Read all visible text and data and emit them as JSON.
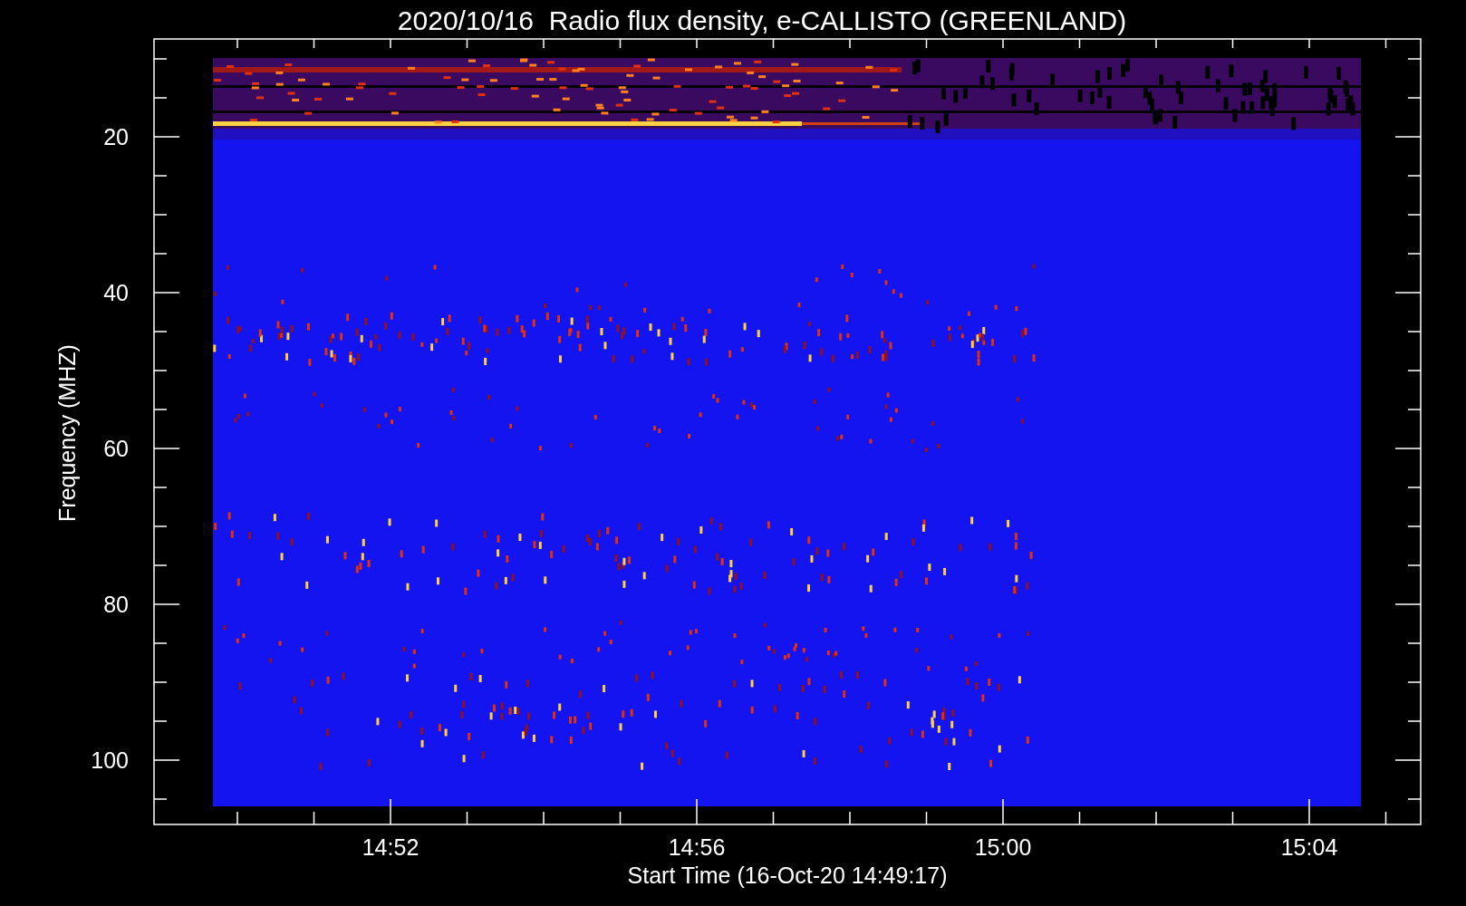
{
  "title": "2020/10/16  Radio flux density, e-CALLISTO (GREENLAND)",
  "plot": {
    "y_label": "Frequency (MHZ)",
    "x_label": "Start Time (16-Oct-20 14:49:17)",
    "y_tick_labels": [
      "20",
      "40",
      "60",
      "80",
      "100"
    ],
    "x_tick_labels": [
      "14:52",
      "14:56",
      "15:00",
      "15:04"
    ]
  }
}
